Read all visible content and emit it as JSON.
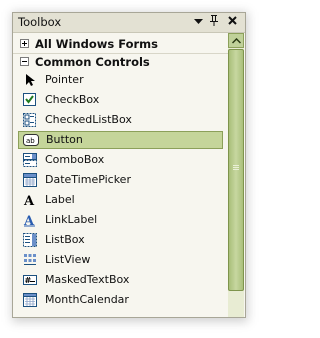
{
  "window": {
    "title": "Toolbox"
  },
  "titlebar_buttons": {
    "dropdown": "▾",
    "pin": "ᵖ",
    "close": "✕"
  },
  "categories": [
    {
      "label": "All Windows Forms",
      "expanded": false
    },
    {
      "label": "Common Controls",
      "expanded": true
    }
  ],
  "items": [
    {
      "label": "Pointer",
      "icon": "pointer-icon"
    },
    {
      "label": "CheckBox",
      "icon": "checkbox-icon"
    },
    {
      "label": "CheckedListBox",
      "icon": "checkedlistbox-icon"
    },
    {
      "label": "Button",
      "icon": "button-icon",
      "selected": true
    },
    {
      "label": "ComboBox",
      "icon": "combobox-icon"
    },
    {
      "label": "DateTimePicker",
      "icon": "datetimepicker-icon"
    },
    {
      "label": "Label",
      "icon": "label-icon"
    },
    {
      "label": "LinkLabel",
      "icon": "linklabel-icon"
    },
    {
      "label": "ListBox",
      "icon": "listbox-icon"
    },
    {
      "label": "ListView",
      "icon": "listview-icon"
    },
    {
      "label": "MaskedTextBox",
      "icon": "maskedtextbox-icon"
    },
    {
      "label": "MonthCalendar",
      "icon": "monthcalendar-icon"
    }
  ],
  "colors": {
    "selection": "#c5d59a",
    "scrollbar": "#a9bf7a"
  }
}
